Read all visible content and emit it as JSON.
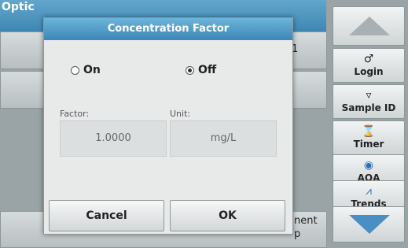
{
  "background": {
    "title_partial": "Optic",
    "row1_fragment": "1",
    "bottom_fragment_1": "nent",
    "bottom_fragment_2": "p"
  },
  "dialog": {
    "title": "Concentration Factor",
    "radio_on_label": "On",
    "radio_off_label": "Off",
    "selected": "Off",
    "factor_label": "Factor:",
    "factor_value": "1.0000",
    "unit_label": "Unit:",
    "unit_value": "mg/L",
    "cancel_label": "Cancel",
    "ok_label": "OK"
  },
  "sidebar": {
    "items": [
      {
        "label": "Login",
        "icon": "person-icon",
        "glyph": "♂"
      },
      {
        "label": "Sample ID",
        "icon": "sample-icon",
        "glyph": "▿"
      },
      {
        "label": "Timer",
        "icon": "timer-icon",
        "glyph": "⌛"
      },
      {
        "label": "AQA",
        "icon": "aqa-icon",
        "glyph": "◉"
      },
      {
        "label": "Trends",
        "icon": "trends-icon",
        "glyph": "⩘"
      }
    ]
  },
  "colors": {
    "header_blue": "#3e86b3",
    "arrow_gray": "#a9b0b3",
    "arrow_blue": "#4a8fc4"
  }
}
